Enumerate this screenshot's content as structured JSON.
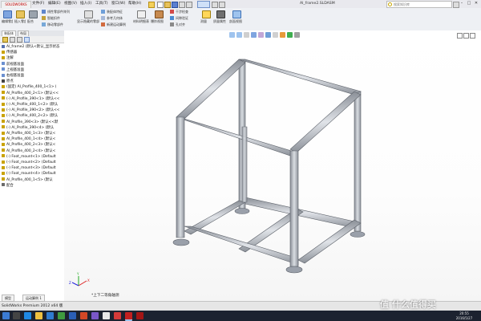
{
  "app": {
    "logo_text": "SOLIDWORKS",
    "menus": [
      "文件(F)",
      "编辑(E)",
      "视图(V)",
      "插入(I)",
      "工具(T)",
      "窗口(W)",
      "帮助(H)"
    ],
    "document_title": "Al_frame2.SLDASM",
    "search_placeholder": "搜索知识库",
    "window_controls": [
      "–",
      "□",
      "✕"
    ]
  },
  "ribbon": {
    "buttons": [
      "编辑零部件",
      "插入零部件",
      "配合",
      "线性零部件阵列",
      "智能扣件",
      "移动零部件",
      "显示隐藏的零部件",
      "装配体特征",
      "参考几何体",
      "新建运动算例",
      "材料明细表",
      "爆炸视图",
      "干涉检查",
      "间隙验证",
      "孔对齐",
      "测量",
      "质量属性",
      "剖面视图"
    ],
    "accent": "#2f6fc9"
  },
  "cmd_tabs": [
    "装配体",
    "布局"
  ],
  "feature_tree": {
    "rows": [
      {
        "label": "Al_frame2 (默认<默认_显示状态",
        "icon": "assembly-icon",
        "color": "#5470b0"
      },
      {
        "label": "传感器",
        "icon": "sensor-icon",
        "color": "#c9a200"
      },
      {
        "label": "注解",
        "icon": "annotation-icon",
        "color": "#c9a200"
      },
      {
        "label": "前视基准面",
        "icon": "plane-icon",
        "color": "#6a8fd0"
      },
      {
        "label": "上视基准面",
        "icon": "plane-icon",
        "color": "#6a8fd0"
      },
      {
        "label": "右视基准面",
        "icon": "plane-icon",
        "color": "#6a8fd0"
      },
      {
        "label": "原点",
        "icon": "origin-icon",
        "color": "#444"
      },
      {
        "label": "(固定) Al_Profile_400_1<1> (",
        "icon": "part-icon",
        "color": "#c9a200"
      },
      {
        "label": "Al_Profile_400_2<1> (默认<<",
        "icon": "part-icon",
        "color": "#c9a200"
      },
      {
        "label": "(-) Al_Profile_390<1> (默认<<",
        "icon": "part-icon",
        "color": "#c9a200"
      },
      {
        "label": "(-) Al_Profile_400_1<2> (默认",
        "icon": "part-icon",
        "color": "#c9a200"
      },
      {
        "label": "(-) Al_Profile_390<2> (默认<<",
        "icon": "part-icon",
        "color": "#c9a200"
      },
      {
        "label": "(-) Al_Profile_400_2<2> (默认",
        "icon": "part-icon",
        "color": "#c9a200"
      },
      {
        "label": "Al_Profile_390<3> (默认<<默",
        "icon": "part-icon",
        "color": "#c9a200"
      },
      {
        "label": "(-) Al_Profile_390<4> (默认",
        "icon": "part-icon",
        "color": "#c9a200"
      },
      {
        "label": "Al_Profile_400_1<3> (默认<",
        "icon": "part-icon",
        "color": "#c9a200"
      },
      {
        "label": "Al_Profile_400_1<4> (默认<",
        "icon": "part-icon",
        "color": "#c9a200"
      },
      {
        "label": "Al_Profile_400_2<3> (默认<",
        "icon": "part-icon",
        "color": "#c9a200"
      },
      {
        "label": "Al_Profile_400_2<4> (默认<",
        "icon": "part-icon",
        "color": "#c9a200"
      },
      {
        "label": "(-) Foot_mount<1> (Default",
        "icon": "part-icon",
        "color": "#c9a200"
      },
      {
        "label": "(-) Foot_mount<2> (Default",
        "icon": "part-icon",
        "color": "#c9a200"
      },
      {
        "label": "(-) Foot_mount<3> (Default",
        "icon": "part-icon",
        "color": "#c9a200"
      },
      {
        "label": "(-) Foot_mount<4> (Default",
        "icon": "part-icon",
        "color": "#c9a200"
      },
      {
        "label": "Al_Profile_400_1<5> (默认",
        "icon": "part-icon",
        "color": "#c9a200"
      },
      {
        "label": "配合",
        "icon": "mates-icon",
        "color": "#6a6a6a"
      }
    ]
  },
  "viewport": {
    "view_label": "*上下二等角轴测",
    "axis_labels": [
      "X",
      "Y",
      "Z"
    ]
  },
  "status": {
    "text": "SolidWorks Premium 2012 x64 版",
    "bottom_tabs": [
      "模型",
      "运动算例 1"
    ]
  },
  "taskbar": {
    "time": "20:55",
    "date": "2016/5/27"
  },
  "watermark": "值 什么值得买"
}
